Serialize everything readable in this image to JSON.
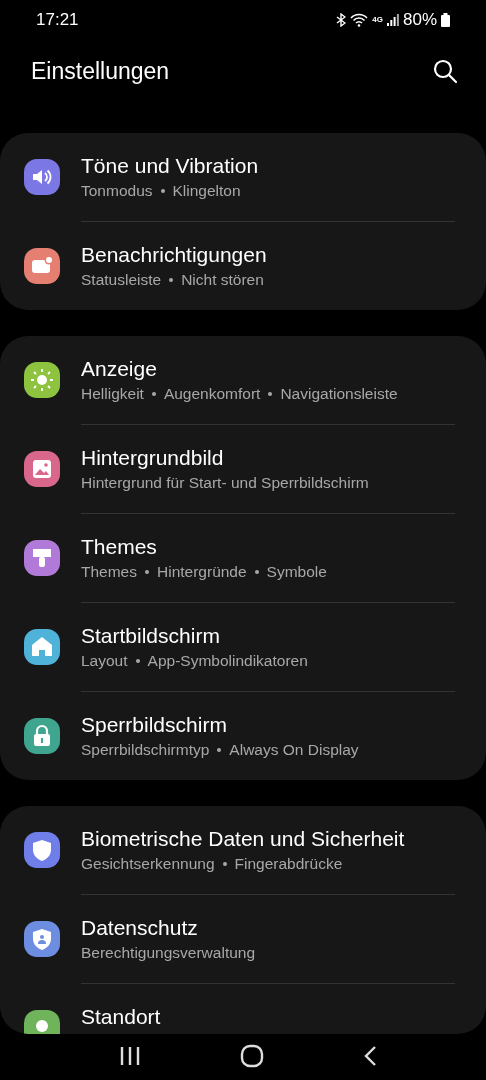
{
  "status_bar": {
    "time": "17:21",
    "network": "4G",
    "battery": "80%"
  },
  "header": {
    "title": "Einstellungen"
  },
  "groups": [
    {
      "items": [
        {
          "title": "Töne und Vibration",
          "subtitle": [
            "Tonmodus",
            "Klingelton"
          ],
          "kind": "sound",
          "color": "#7b78e6"
        },
        {
          "title": "Benachrichtigungen",
          "subtitle": [
            "Statusleiste",
            "Nicht stören"
          ],
          "kind": "notification",
          "color": "#e47f72"
        }
      ]
    },
    {
      "items": [
        {
          "title": "Anzeige",
          "subtitle": [
            "Helligkeit",
            "Augenkomfort",
            "Navigationsleiste"
          ],
          "kind": "sun",
          "color": "#8ec33f"
        },
        {
          "title": "Hintergrundbild",
          "subtitle": [
            "Hintergrund für Start- und Sperrbildschirm"
          ],
          "kind": "image",
          "color": "#d9678c"
        },
        {
          "title": "Themes",
          "subtitle": [
            "Themes",
            "Hintergründe",
            "Symbole"
          ],
          "kind": "brush",
          "color": "#b27ad8"
        },
        {
          "title": "Startbildschirm",
          "subtitle": [
            "Layout",
            "App-Symbolindikatoren"
          ],
          "kind": "home",
          "color": "#4fb3d9"
        },
        {
          "title": "Sperrbildschirm",
          "subtitle": [
            "Sperrbildschirmtyp",
            "Always On Display"
          ],
          "kind": "lock",
          "color": "#3fa58f"
        }
      ]
    },
    {
      "items": [
        {
          "title": "Biometrische Daten und Sicherheit",
          "subtitle": [
            "Gesichtserkennung",
            "Fingerabdrücke"
          ],
          "kind": "shield",
          "color": "#6f7ee8"
        },
        {
          "title": "Datenschutz",
          "subtitle": [
            "Berechtigungsverwaltung"
          ],
          "kind": "privacy",
          "color": "#6d8de0"
        },
        {
          "title": "Standort",
          "kind": "location",
          "color": "#6fb45a"
        }
      ]
    }
  ]
}
